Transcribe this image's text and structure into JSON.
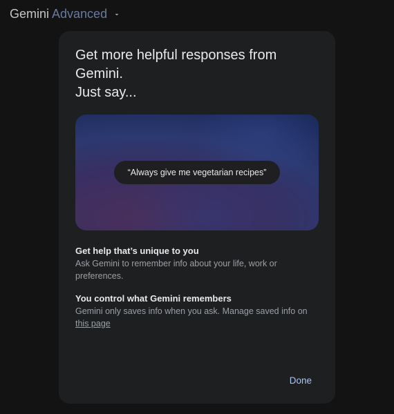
{
  "header": {
    "brand_name": "Gemini",
    "brand_tier": "Advanced"
  },
  "modal": {
    "title_line1": "Get more helpful responses from Gemini.",
    "title_line2": "Just say...",
    "example_chip": "“Always give me vegetarian recipes”",
    "sections": [
      {
        "title": "Get help that’s unique to you",
        "body": "Ask Gemini to remember info about your life, work or preferences."
      },
      {
        "title": "You control what Gemini remembers",
        "body_prefix": "Gemini only saves info when you ask. Manage saved info on ",
        "link_text": "this page"
      }
    ],
    "done_label": "Done"
  }
}
